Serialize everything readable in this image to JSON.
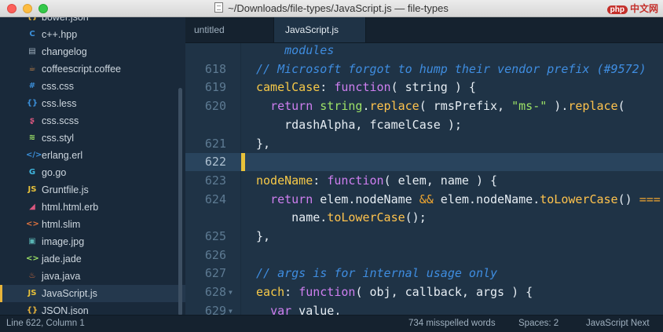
{
  "window": {
    "title": "~/Downloads/file-types/JavaScript.js — file-types",
    "watermark_logo": "php",
    "watermark_text": "中文网"
  },
  "sidebar": {
    "items": [
      {
        "name": "bower.json",
        "icon": "{}",
        "icon_color": "#e8b43a"
      },
      {
        "name": "c++.hpp",
        "icon": "C",
        "icon_color": "#3b8fd9"
      },
      {
        "name": "changelog",
        "icon": "▤",
        "icon_color": "#9fb0bf"
      },
      {
        "name": "coffeescript.coffee",
        "icon": "☕",
        "icon_color": "#c8874a"
      },
      {
        "name": "css.css",
        "icon": "#",
        "icon_color": "#3b8fd9"
      },
      {
        "name": "css.less",
        "icon": "{}",
        "icon_color": "#3b8fd9"
      },
      {
        "name": "css.scss",
        "icon": "ʂ",
        "icon_color": "#d9577f"
      },
      {
        "name": "css.styl",
        "icon": "≋",
        "icon_color": "#9de367"
      },
      {
        "name": "erlang.erl",
        "icon": "</>",
        "icon_color": "#3b8fd9"
      },
      {
        "name": "go.go",
        "icon": "G",
        "icon_color": "#3fb7e0"
      },
      {
        "name": "Gruntfile.js",
        "icon": "JS",
        "icon_color": "#e8c23a"
      },
      {
        "name": "html.html.erb",
        "icon": "◢",
        "icon_color": "#d9577f"
      },
      {
        "name": "html.slim",
        "icon": "<>",
        "icon_color": "#e0733f"
      },
      {
        "name": "image.jpg",
        "icon": "▣",
        "icon_color": "#59b3b3"
      },
      {
        "name": "jade.jade",
        "icon": "<>",
        "icon_color": "#9de367"
      },
      {
        "name": "java.java",
        "icon": "♨",
        "icon_color": "#e0733f"
      },
      {
        "name": "JavaScript.js",
        "icon": "JS",
        "icon_color": "#e8c23a",
        "active": true
      },
      {
        "name": "JSON.json",
        "icon": "{}",
        "icon_color": "#e8b43a"
      }
    ]
  },
  "tabs": [
    {
      "label": "untitled"
    },
    {
      "label": "JavaScript.js"
    }
  ],
  "editor": {
    "lines": [
      {
        "num": "",
        "segments": [
          [
            "    ",
            ""
          ],
          [
            "modules",
            "c-com"
          ]
        ]
      },
      {
        "num": "618",
        "segments": [
          [
            "// Microsoft forgot to hump their vendor prefix (#9572)",
            "c-com"
          ]
        ]
      },
      {
        "num": "619",
        "segments": [
          [
            "camelCase",
            "c-key"
          ],
          [
            ": ",
            "c-par"
          ],
          [
            "function",
            "c-fn"
          ],
          [
            "( string ) {",
            "c-par"
          ]
        ]
      },
      {
        "num": "620",
        "segments": [
          [
            "  ",
            ""
          ],
          [
            "return",
            "c-fn"
          ],
          [
            " ",
            ""
          ],
          [
            "string",
            "c-str"
          ],
          [
            ".",
            "c-par"
          ],
          [
            "replace",
            "c-meth"
          ],
          [
            "( rmsPrefix, ",
            "c-par"
          ],
          [
            "\"ms-\"",
            "c-str"
          ],
          [
            " ).",
            "c-par"
          ],
          [
            "replace",
            "c-meth"
          ],
          [
            "(",
            "c-par"
          ]
        ]
      },
      {
        "num": "",
        "segments": [
          [
            "    rdashAlpha, fcamelCase );",
            "c-par"
          ]
        ]
      },
      {
        "num": "621",
        "segments": [
          [
            "},",
            "c-par"
          ]
        ]
      },
      {
        "num": "622",
        "segments": [],
        "current": true
      },
      {
        "num": "623",
        "segments": [
          [
            "nodeName",
            "c-key"
          ],
          [
            ": ",
            "c-par"
          ],
          [
            "function",
            "c-fn"
          ],
          [
            "( elem, name ) {",
            "c-par"
          ]
        ]
      },
      {
        "num": "624",
        "segments": [
          [
            "  ",
            ""
          ],
          [
            "return",
            "c-fn"
          ],
          [
            " elem.nodeName ",
            "c-par"
          ],
          [
            "&&",
            "c-op"
          ],
          [
            " elem.nodeName.",
            "c-par"
          ],
          [
            "toLowerCase",
            "c-meth"
          ],
          [
            "() ",
            "c-par"
          ],
          [
            "===",
            "c-op"
          ]
        ]
      },
      {
        "num": "",
        "segments": [
          [
            "     name.",
            "c-par"
          ],
          [
            "toLowerCase",
            "c-meth"
          ],
          [
            "();",
            "c-par"
          ]
        ]
      },
      {
        "num": "625",
        "segments": [
          [
            "},",
            "c-par"
          ]
        ]
      },
      {
        "num": "626",
        "segments": []
      },
      {
        "num": "627",
        "segments": [
          [
            "// args is for internal usage only",
            "c-com"
          ]
        ]
      },
      {
        "num": "628",
        "segments": [
          [
            "each",
            "c-key"
          ],
          [
            ": ",
            "c-par"
          ],
          [
            "function",
            "c-fn"
          ],
          [
            "( obj, callback, args ) {",
            "c-par"
          ]
        ],
        "fold": true
      },
      {
        "num": "629",
        "segments": [
          [
            "  ",
            ""
          ],
          [
            "var",
            "c-fn"
          ],
          [
            " value,",
            "c-par"
          ]
        ],
        "fold": true
      }
    ]
  },
  "status": {
    "position": "Line 622, Column 1",
    "spelling": "734 misspelled words",
    "indent": "Spaces: 2",
    "syntax": "JavaScript Next"
  }
}
